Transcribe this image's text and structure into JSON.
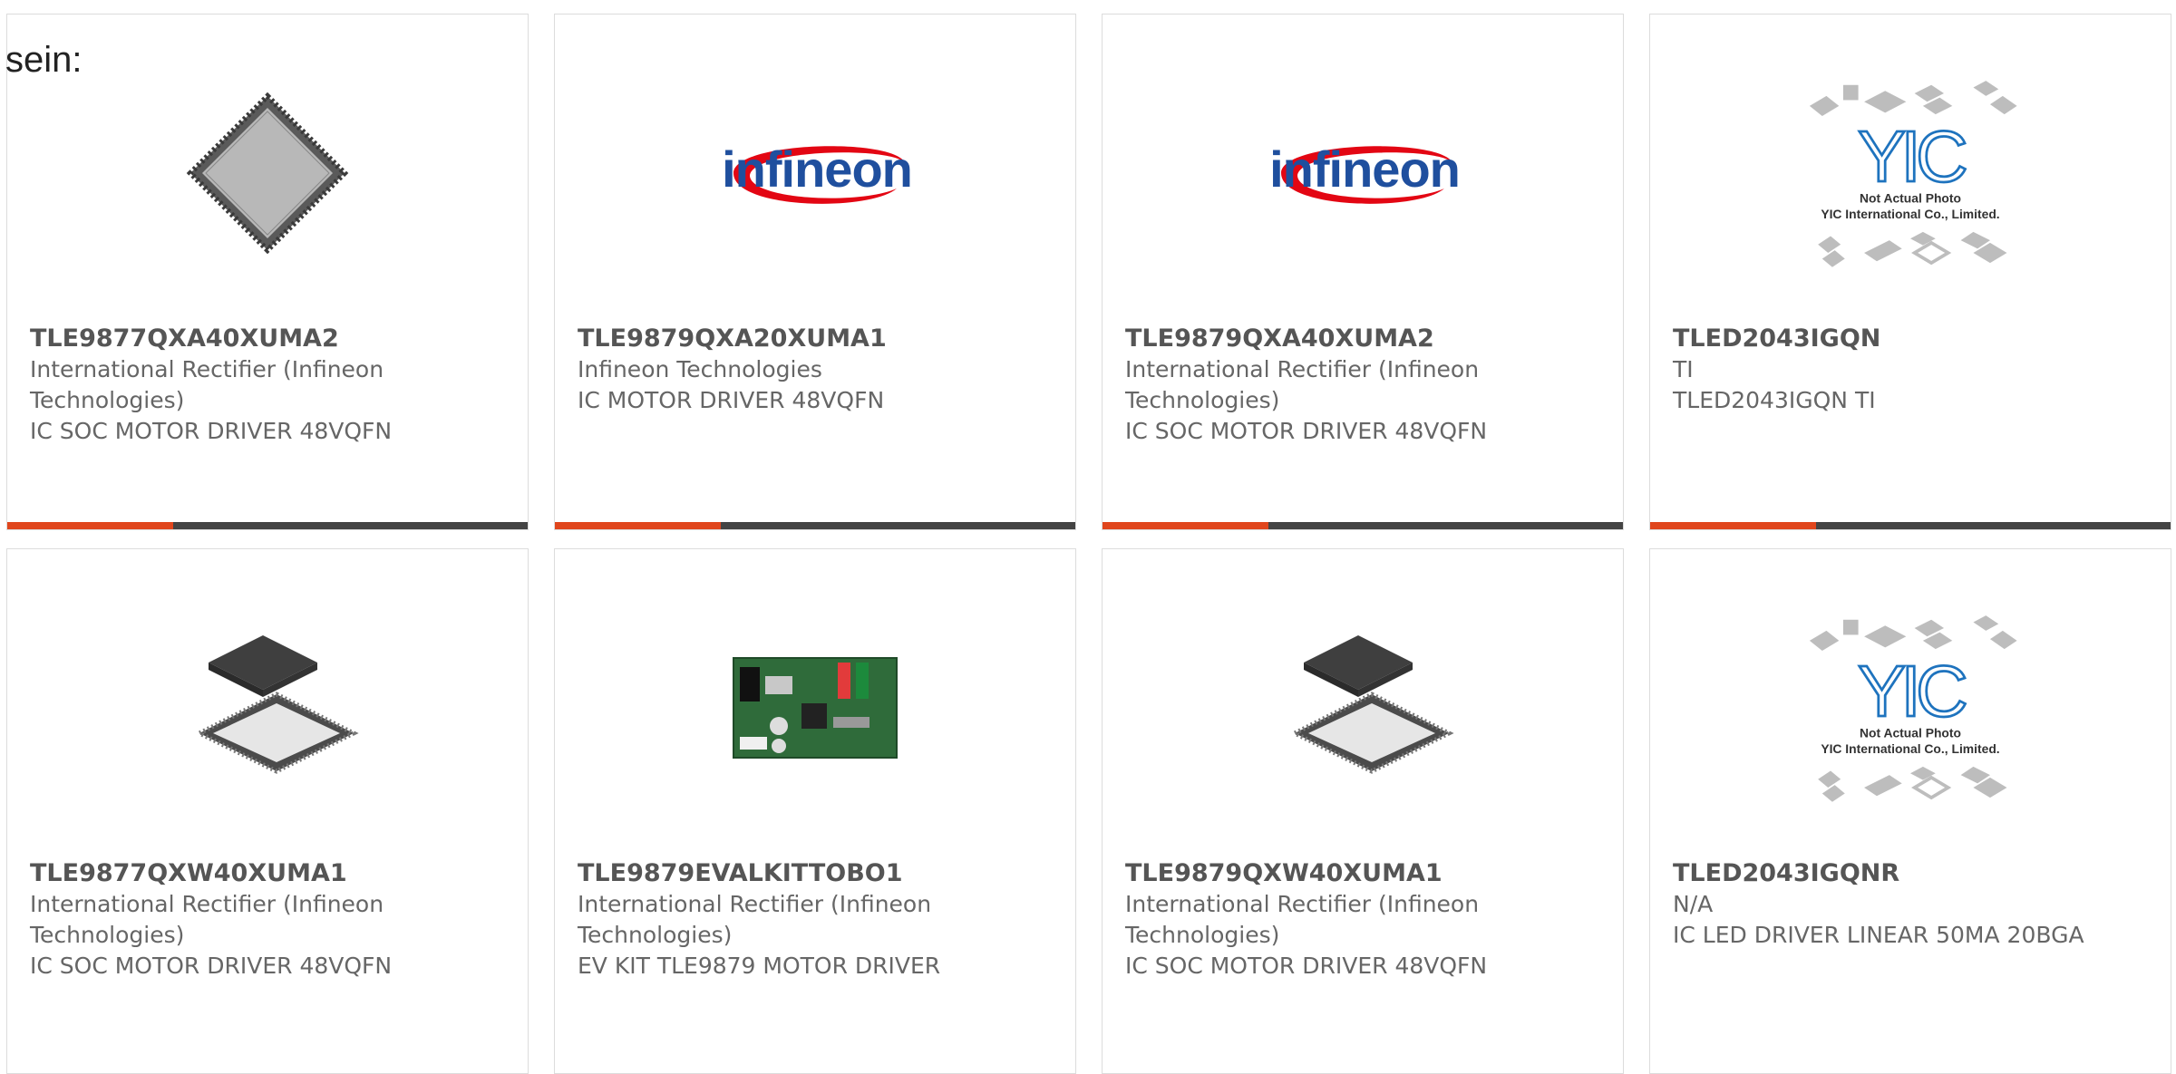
{
  "page": {
    "label": "sein:"
  },
  "colors": {
    "accent": "#e0461d",
    "bar_dark": "#444444",
    "pn_text": "#555555",
    "meta_text": "#666666",
    "border": "#dcdcdc"
  },
  "products": [
    {
      "part_number": "TLE9877QXA40XUMA2",
      "manufacturer": "International Rectifier (Infineon Technologies)",
      "description": "IC SOC MOTOR DRIVER 48VQFN",
      "image": "qfn-chip-top-icon"
    },
    {
      "part_number": "TLE9879QXA20XUMA1",
      "manufacturer": "Infineon Technologies",
      "description": "IC MOTOR DRIVER 48VQFN",
      "image": "infineon-logo",
      "logo_text": "infineon"
    },
    {
      "part_number": "TLE9879QXA40XUMA2",
      "manufacturer": "International Rectifier (Infineon Technologies)",
      "description": "IC SOC MOTOR DRIVER 48VQFN",
      "image": "infineon-logo",
      "logo_text": "infineon"
    },
    {
      "part_number": "TLED2043IGQN",
      "manufacturer": "TI",
      "description": "TLED2043IGQN TI",
      "image": "yic-placeholder",
      "placeholder_brand": "YIC",
      "placeholder_line1": "Not Actual Photo",
      "placeholder_line2": "YIC International Co., Limited."
    },
    {
      "part_number": "TLE9877QXW40XUMA1",
      "manufacturer": "International Rectifier (Infineon Technologies)",
      "description": "IC SOC MOTOR DRIVER 48VQFN",
      "image": "qfn-chip-pair-icon"
    },
    {
      "part_number": "TLE9879EVALKITTOBO1",
      "manufacturer": "International Rectifier (Infineon Technologies)",
      "description": "EV KIT TLE9879 MOTOR DRIVER",
      "image": "eval-board-icon"
    },
    {
      "part_number": "TLE9879QXW40XUMA1",
      "manufacturer": "International Rectifier (Infineon Technologies)",
      "description": "IC SOC MOTOR DRIVER 48VQFN",
      "image": "qfn-chip-pair-icon"
    },
    {
      "part_number": "TLED2043IGQNR",
      "manufacturer": "N/A",
      "description": "IC LED DRIVER LINEAR 50MA 20BGA",
      "image": "yic-placeholder",
      "placeholder_brand": "YIC",
      "placeholder_line1": "Not Actual Photo",
      "placeholder_line2": "YIC International Co., Limited."
    }
  ]
}
